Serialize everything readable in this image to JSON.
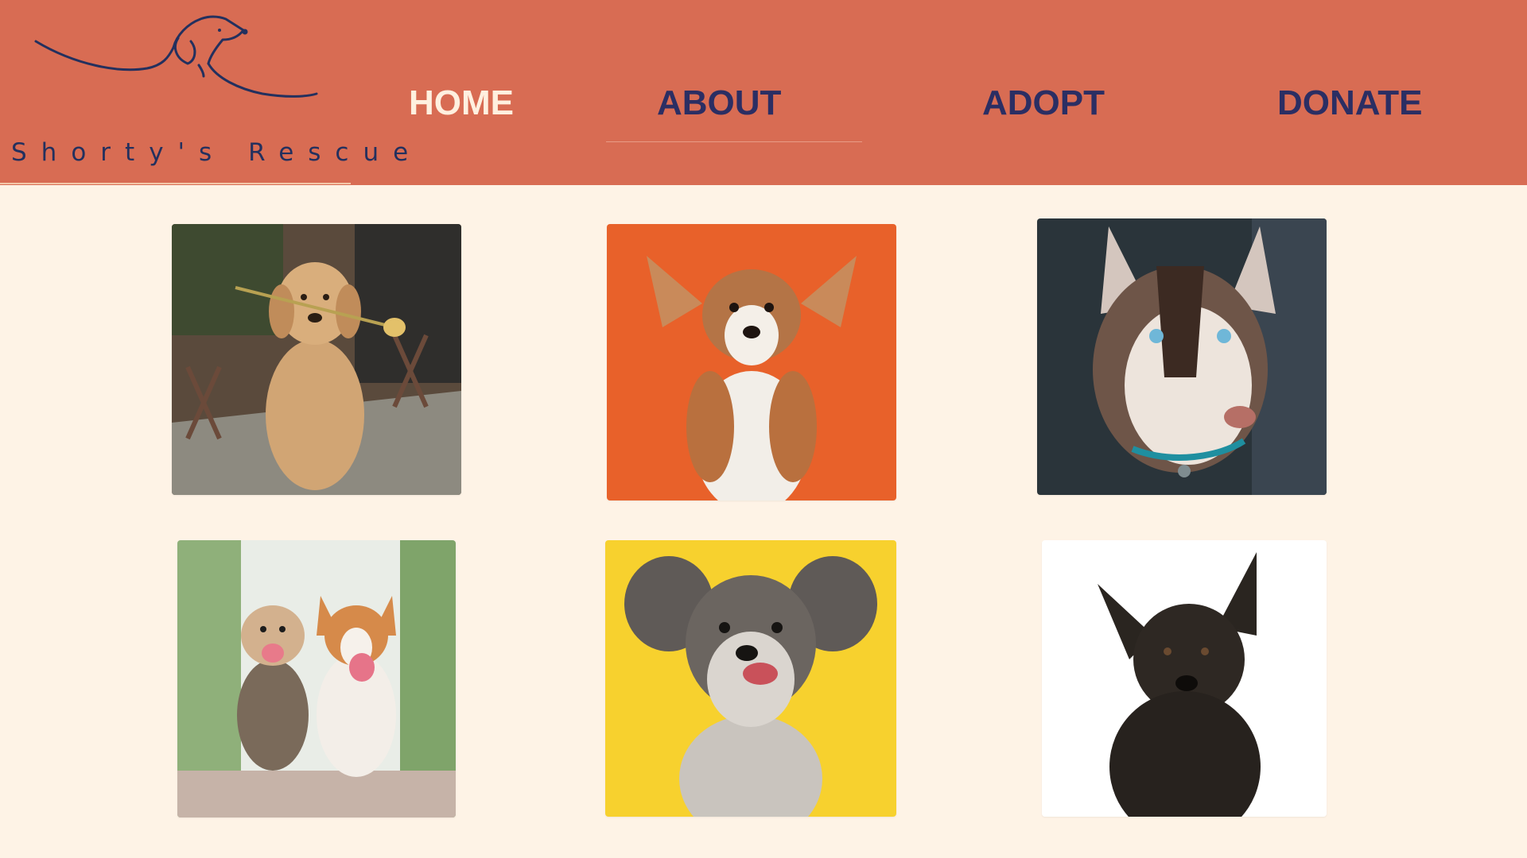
{
  "brand": {
    "name": "Shorty's Rescue"
  },
  "nav": [
    {
      "label": "HOME"
    },
    {
      "label": "ABOUT"
    },
    {
      "label": "ADOPT"
    },
    {
      "label": "DONATE"
    }
  ],
  "gallery": [
    {
      "icon": "golden-retriever-photo"
    },
    {
      "icon": "corgi-puppy-photo"
    },
    {
      "icon": "husky-photo"
    },
    {
      "icon": "two-dogs-running-photo"
    },
    {
      "icon": "schnauzer-photo"
    },
    {
      "icon": "black-dog-photo"
    }
  ],
  "colors": {
    "header": "#D86C53",
    "page_background": "#FEF3E6",
    "nav_text": "#2B2E63",
    "nav_active_text": "#FFF0DF",
    "logo_ink": "#23305E"
  }
}
